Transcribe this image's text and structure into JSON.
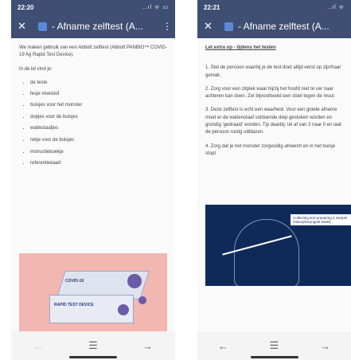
{
  "phone1": {
    "status": {
      "time": "22:20",
      "icons": "..ıl ᯤ ▭"
    },
    "appbar": {
      "close": "✕",
      "title": "- Afname zelftest (A...",
      "menu": "⋮"
    },
    "intro": "We maken gebruik van een Abbott zelftest (Abbott PANBIO™ COVID-19 Ag Rapid Test Device).",
    "kit_heading": "In de kit vind je:",
    "kit_items": [
      "de teste",
      "fesje vloeistof",
      "buisjes voor het monster",
      "dopjes voor de buisjes",
      "wattestaafjes"
    ],
    "kit_items_2": [
      "rekje voor de buisjes",
      "instructieboekje",
      "referentiekaart"
    ],
    "product_text_1": "COVID-19",
    "product_text_2": "RAPID TEST DEVICE",
    "nav": {
      "back": "←",
      "home": "☰",
      "forward": "→"
    }
  },
  "phone2": {
    "status": {
      "time": "22:21",
      "icons": "..ıl ᯤ"
    },
    "appbar": {
      "close": "✕",
      "title": "- Afname zelftest (A..."
    },
    "heading": "Let extra op - tijdens het testen",
    "steps": [
      "1. Stel de persoon waarbij je de test doet altijd eerst op zijn/haar gemak.",
      "2. Zorg voor een zitplek waar hij/zij het hoofd niet te ver naar achteren kan doen. Zet bijvoorbeeld een stoel tegen de muur.",
      "3. Deze zelftest is echt een waarheid. Voor een goede afname moet er de wattenstaaf voldoende diep gestoken worden en grondig 'gedraaid' worden. Tip daarbij: tel af van 3 naar 0 en laat de persoon rustig uitblazen.",
      "4. Zorg dat je het monster zorgvuldig afneemt en in het buisje stopt."
    ],
    "illustration_label": "Collecting and preparing a sample (Nasopharyngeal swab)",
    "nav": {
      "back": "←",
      "home": "☰",
      "forward": "→"
    }
  }
}
